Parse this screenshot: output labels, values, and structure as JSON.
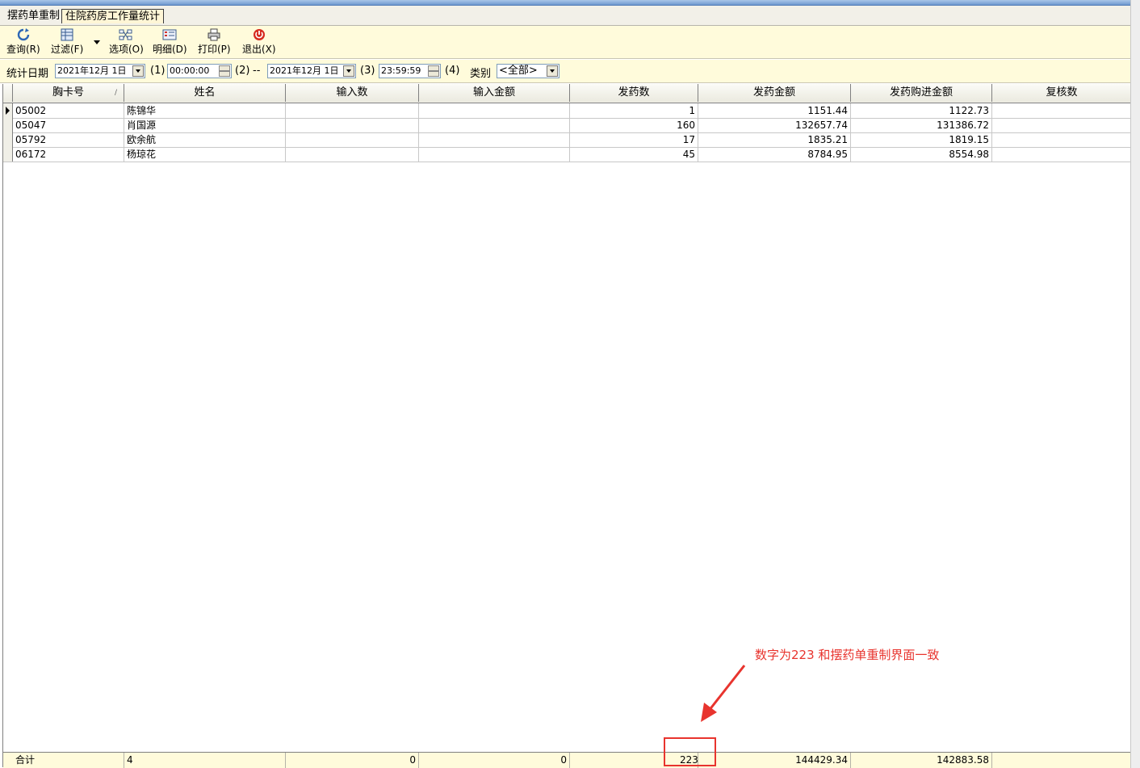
{
  "tabs": [
    {
      "label": "摆药单重制"
    },
    {
      "label": "住院药房工作量统计"
    }
  ],
  "toolbar": {
    "query": "查询(R)",
    "filter": "过滤(F)",
    "options": "选项(O)",
    "detail": "明细(D)",
    "print": "打印(P)",
    "exit": "退出(X)"
  },
  "filters": {
    "label": "统计日期",
    "start_date": "2021年12月 1日",
    "marker1": "(1)",
    "start_time": "00:00:00",
    "marker2": "(2)",
    "dash": "--",
    "end_date": "2021年12月 1日",
    "marker3": "(3)",
    "end_time": "23:59:59",
    "marker4": "(4)",
    "category_label": "类别",
    "category_value": "<全部>"
  },
  "table": {
    "columns": [
      "胸卡号",
      "姓名",
      "输入数",
      "输入金额",
      "发药数",
      "发药金额",
      "发药购进金额",
      "复核数"
    ],
    "rows": [
      {
        "card": "05002",
        "name": "陈锦华",
        "input_count": "",
        "input_amount": "",
        "dispense_count": "1",
        "dispense_amount": "1151.44",
        "purchase_amount": "1122.73",
        "review_count": ""
      },
      {
        "card": "05047",
        "name": "肖国源",
        "input_count": "",
        "input_amount": "",
        "dispense_count": "160",
        "dispense_amount": "132657.74",
        "purchase_amount": "131386.72",
        "review_count": ""
      },
      {
        "card": "05792",
        "name": "欧余航",
        "input_count": "",
        "input_amount": "",
        "dispense_count": "17",
        "dispense_amount": "1835.21",
        "purchase_amount": "1819.15",
        "review_count": ""
      },
      {
        "card": "06172",
        "name": "杨琼花",
        "input_count": "",
        "input_amount": "",
        "dispense_count": "45",
        "dispense_amount": "8784.95",
        "purchase_amount": "8554.98",
        "review_count": ""
      }
    ],
    "footer": {
      "label": "合计",
      "count": "4",
      "input_count": "0",
      "input_amount": "0",
      "dispense_count": "223",
      "dispense_amount": "144429.34",
      "purchase_amount": "142883.58",
      "review_count": ""
    }
  },
  "annotation": {
    "text": "数字为223  和摆药单重制界面一致",
    "color": "#e8342e"
  }
}
